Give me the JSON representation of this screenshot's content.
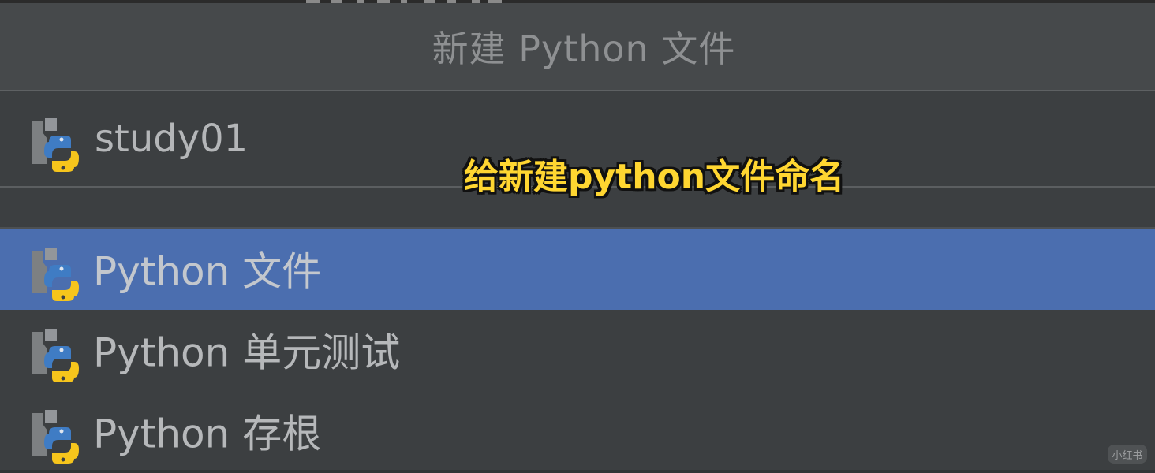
{
  "dialog": {
    "title": "新建 Python 文件",
    "name_value": "study01",
    "name_placeholder": ""
  },
  "file_types": [
    {
      "label": "Python 文件",
      "selected": true,
      "icon": "python-file-icon"
    },
    {
      "label": "Python 单元测试",
      "selected": false,
      "icon": "python-file-icon"
    },
    {
      "label": "Python 存根",
      "selected": false,
      "icon": "python-file-icon"
    }
  ],
  "overlay": {
    "caption": "给新建python文件命名",
    "watermark": "小红书"
  },
  "colors": {
    "background": "#3c3f41",
    "title_bar": "#46494b",
    "selection": "#4b6eaf",
    "caption": "#ffd631",
    "python_blue": "#3f7cc4",
    "python_yellow": "#f6c51c"
  }
}
